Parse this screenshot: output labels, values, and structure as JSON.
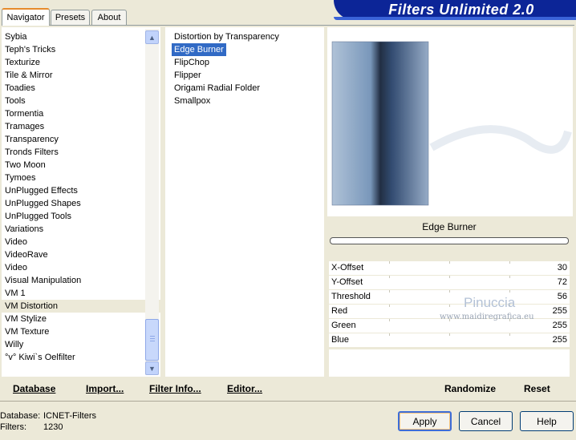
{
  "tabs": [
    {
      "label": "Navigator"
    },
    {
      "label": "Presets"
    },
    {
      "label": "About"
    }
  ],
  "app_title": "Filters Unlimited 2.0",
  "categories": [
    "Sybia",
    "Teph's Tricks",
    "Texturize",
    "Tile & Mirror",
    "Toadies",
    "Tools",
    "Tormentia",
    "Tramages",
    "Transparency",
    "Tronds Filters",
    "Two Moon",
    "Tymoes",
    "UnPlugged Effects",
    "UnPlugged Shapes",
    "UnPlugged Tools",
    "Variations",
    "Video",
    "VideoRave",
    "Video",
    "Visual Manipulation",
    "VM 1",
    "VM Distortion",
    "VM Stylize",
    "VM Texture",
    "Willy",
    "°v° Kiwi`s Oelfilter"
  ],
  "selected_category": "VM Distortion",
  "filters": [
    "Distortion by Transparency",
    "Edge Burner",
    "FlipChop",
    "Flipper",
    "Origami Radial Folder",
    "Smallpox"
  ],
  "selected_filter": "Edge Burner",
  "filter_name": "Edge Burner",
  "params": [
    {
      "label": "X-Offset",
      "value": "30"
    },
    {
      "label": "Y-Offset",
      "value": "72"
    },
    {
      "label": "Threshold",
      "value": "56"
    },
    {
      "label": "Red",
      "value": "255"
    },
    {
      "label": "Green",
      "value": "255"
    },
    {
      "label": "Blue",
      "value": "255"
    }
  ],
  "watermark": {
    "name": "Pinuccia",
    "site": "www.maidiregrafica.eu"
  },
  "links": {
    "database": "Database",
    "import": "Import...",
    "filter_info": "Filter Info...",
    "editor": "Editor...",
    "randomize": "Randomize",
    "reset": "Reset"
  },
  "status": {
    "database_label": "Database:",
    "database_value": "ICNET-Filters",
    "filters_label": "Filters:",
    "filters_value": "1230"
  },
  "buttons": {
    "apply": "Apply",
    "cancel": "Cancel",
    "help": "Help"
  },
  "colors": {
    "selection": "#316ac5",
    "banner": "#0c2597",
    "background": "#ece9d8"
  }
}
